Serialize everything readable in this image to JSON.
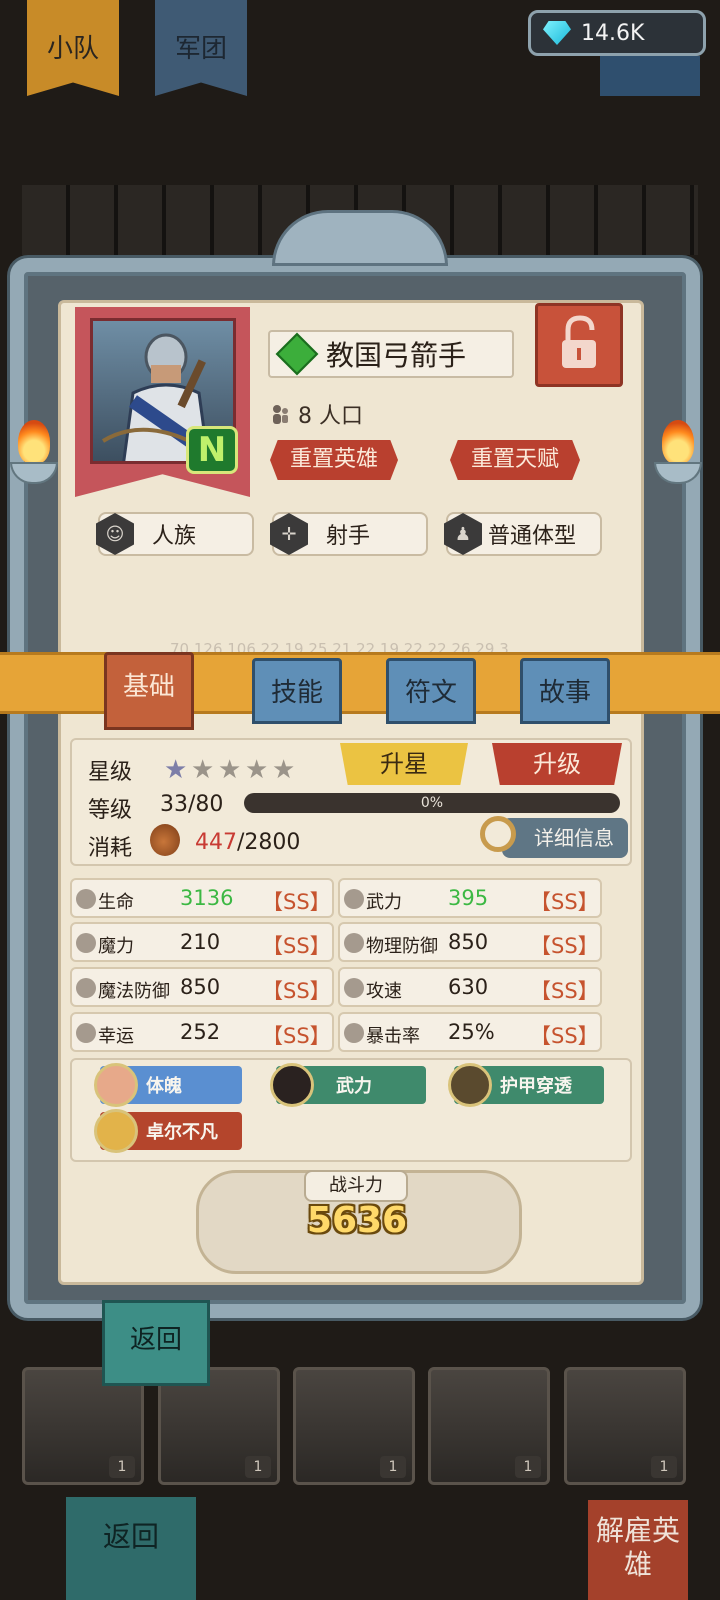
{
  "top_tabs": {
    "squad": "小队",
    "legion": "军团"
  },
  "currency": {
    "gems": "14.6K",
    "icon": "diamond-icon"
  },
  "hero": {
    "name": "教国弓箭手",
    "rarity": "N",
    "population": "8 人口",
    "reset_hero": "重置英雄",
    "reset_talent": "重置天赋",
    "tags": [
      "人族",
      "射手",
      "普通体型"
    ]
  },
  "debug_line": "70,126,106,22,19,25,21,22,19,22,22,26,29,3",
  "tabs": [
    "基础",
    "技能",
    "符文",
    "故事"
  ],
  "basic": {
    "star_label": "星级",
    "stars_filled": 1,
    "stars_total": 5,
    "star_up": "升星",
    "level_up": "升级",
    "level_label": "等级",
    "level_value": "33/80",
    "level_progress": "0%",
    "level_progress_fraction": 0,
    "cost_label": "消耗",
    "cost_have": "447",
    "cost_need": "/2800",
    "detail": "详细信息"
  },
  "stats": [
    {
      "name": "生命",
      "value": "3136",
      "grade": "【SS】",
      "highlight": true
    },
    {
      "name": "武力",
      "value": "395",
      "grade": "【SS】",
      "highlight": true
    },
    {
      "name": "魔力",
      "value": "210",
      "grade": "【SS】",
      "highlight": false
    },
    {
      "name": "物理防御",
      "value": "850",
      "grade": "【SS】",
      "highlight": false
    },
    {
      "name": "魔法防御",
      "value": "850",
      "grade": "【SS】",
      "highlight": false
    },
    {
      "name": "攻速",
      "value": "630",
      "grade": "【SS】",
      "highlight": false
    },
    {
      "name": "幸运",
      "value": "252",
      "grade": "【SS】",
      "highlight": false
    },
    {
      "name": "暴击率",
      "value": "25%",
      "grade": "【SS】",
      "highlight": false
    }
  ],
  "traits": [
    "体魄",
    "武力",
    "护甲穿透",
    "卓尔不凡"
  ],
  "power": {
    "label": "战斗力",
    "value": "5636"
  },
  "buttons": {
    "back": "返回",
    "back_bottom": "返回",
    "dismiss": "解雇英雄"
  },
  "roster_counts": [
    "1",
    "1",
    "1",
    "1",
    "1"
  ],
  "colors": {
    "accent_red": "#b9402f",
    "ribbon": "#e6a437",
    "stat_green": "#3cb843",
    "grade": "#c6532e"
  }
}
